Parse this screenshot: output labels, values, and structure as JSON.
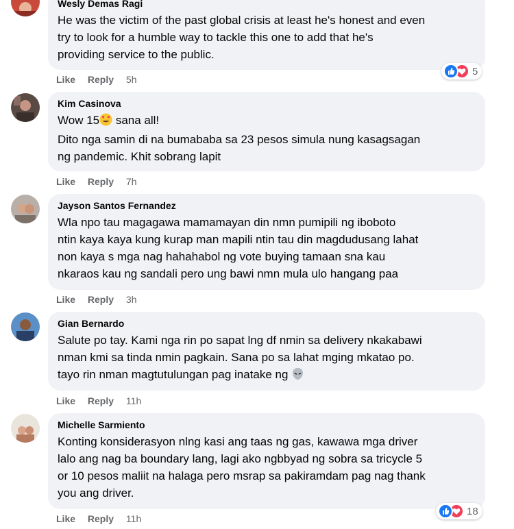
{
  "comments": [
    {
      "name": "Wesly Demas Ragi",
      "lines": [
        "He was the victim of the past global crisis at least he's honest and even",
        "try to look for a humble way to tackle this one to add that he's",
        "providing service to the public."
      ],
      "like_label": "Like",
      "reply_label": "Reply",
      "time": "5h",
      "reaction_count": "5",
      "avatar_icon": "avatar-photo-icon"
    },
    {
      "name": "Kim Casinova",
      "lines": [
        "Wow 15",
        "Dito nga samin di na bumababa sa 23 pesos simula nung kasagsagan",
        "ng pandemic. Khit sobrang lapit"
      ],
      "line1_suffix": " sana all!",
      "like_label": "Like",
      "reply_label": "Reply",
      "time": "7h",
      "avatar_icon": "avatar-photo-icon"
    },
    {
      "name": "Jayson Santos Fernandez",
      "lines": [
        "Wla npo tau magagawa mamamayan din nmn pumipili ng iboboto",
        "ntin kaya kaya kung kurap man mapili ntin tau din magdudusang lahat",
        "non kaya s mga nag hahahabol ng vote buying tamaan sna kau",
        "nkaraos kau ng sandali pero ung bawi nmn mula ulo hangang paa"
      ],
      "like_label": "Like",
      "reply_label": "Reply",
      "time": "3h",
      "avatar_icon": "avatar-photo-icon"
    },
    {
      "name": "Gian Bernardo",
      "lines": [
        "Salute po tay. Kami nga rin po sapat lng df nmin sa delivery nkakabawi",
        "nman kmi sa tinda nmin pagkain. Sana po sa lahat mging mkatao po.",
        "tayo rin nman magtutulungan pag inatake ng"
      ],
      "like_label": "Like",
      "reply_label": "Reply",
      "time": "11h",
      "avatar_icon": "avatar-photo-icon"
    },
    {
      "name": "Michelle Sarmiento",
      "lines": [
        "Konting konsiderasyon nlng kasi ang taas ng gas, kawawa mga driver",
        "lalo ang nag ba boundary lang, lagi ako ngbbyad ng sobra sa tricycle 5",
        "or 10 pesos maliit na halaga pero msrap sa pakiramdam pag nag thank",
        "you ang driver."
      ],
      "like_label": "Like",
      "reply_label": "Reply",
      "time": "11h",
      "reaction_count": "18",
      "avatar_icon": "avatar-photo-icon"
    }
  ],
  "colors": {
    "bubble": "#f0f2f5",
    "meta": "#65676b",
    "like_blue": "#1877f2",
    "love_red": "#f33e58"
  }
}
